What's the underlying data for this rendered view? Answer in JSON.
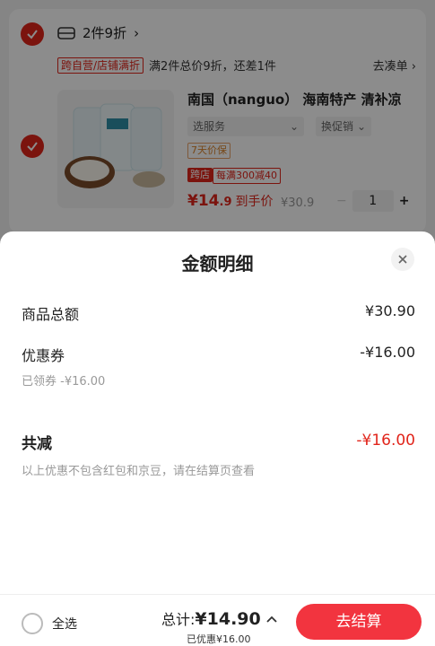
{
  "colors": {
    "accent": "#e1251b",
    "checkout": "#f2343f"
  },
  "cart": {
    "promo_label": "2件9折",
    "promo_tag": "跨自营/店铺满折",
    "promo_desc": "满2件总价9折，还差1件",
    "gather_label": "去凑单",
    "product": {
      "name": "南国（nanguo） 海南特产 清补凉",
      "service_select": "选服务",
      "promo_select": "换促销",
      "tag_price_protect": "7天价保",
      "tag_store": "跨店",
      "tag_store_promo": "每满300减40",
      "price_symbol": "¥",
      "price_int": "14",
      "price_dec": ".9",
      "price_label": "到手价",
      "original_price": "¥30.9",
      "quantity": "1"
    }
  },
  "sheet": {
    "title": "金额明细",
    "rows": {
      "goods_label": "商品总额",
      "goods_value": "¥30.90",
      "coupon_label": "优惠券",
      "coupon_value": "-¥16.00",
      "coupon_note": "已领券 -¥16.00",
      "total_label": "共减",
      "total_value": "-¥16.00",
      "disclaimer": "以上优惠不包含红包和京豆，请在结算页查看"
    }
  },
  "bottom": {
    "select_all": "全选",
    "total_prefix": "总计:",
    "total_amount": "¥14.90",
    "saved": "已优惠¥16.00",
    "checkout_label": "去结算"
  }
}
